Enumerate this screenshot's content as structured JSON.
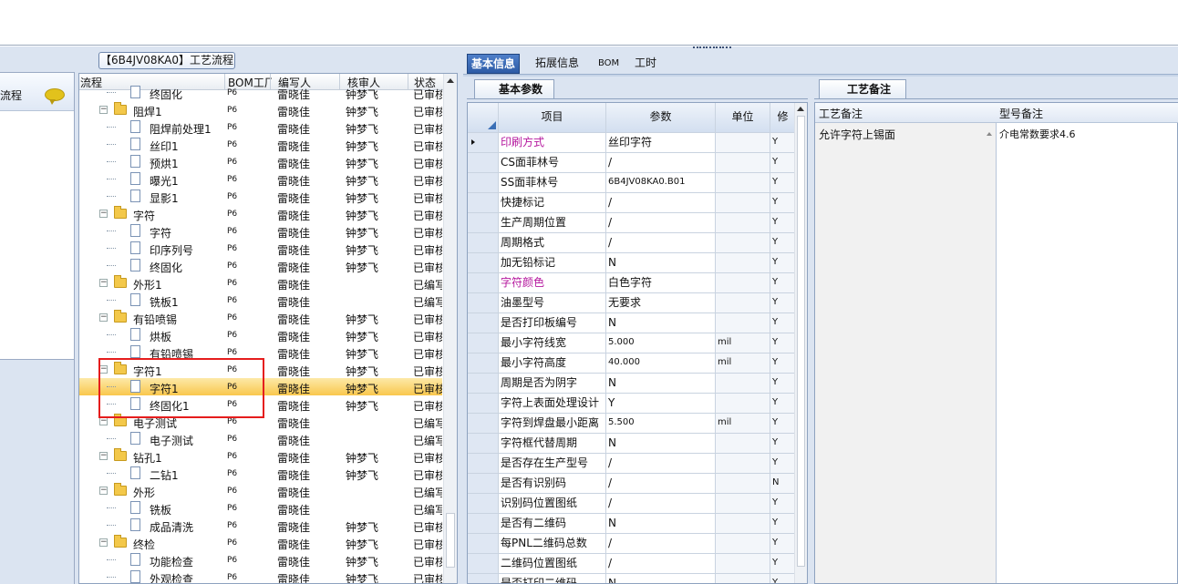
{
  "left_panel": {
    "label": "流程"
  },
  "tree": {
    "title": "【6B4JV08KA0】工艺流程",
    "columns": [
      "流程",
      "BOM工厂",
      "编写人",
      "核审人",
      "状态"
    ],
    "rows": [
      {
        "level": 2,
        "type": "doc",
        "name": "终固化",
        "bom": "P6",
        "author": "雷晓佳",
        "reviewer": "钟梦飞",
        "status": "已审核"
      },
      {
        "level": 1,
        "type": "folder",
        "name": "阻焊1",
        "bom": "P6",
        "author": "雷晓佳",
        "reviewer": "钟梦飞",
        "status": "已审核"
      },
      {
        "level": 2,
        "type": "doc",
        "name": "阻焊前处理1",
        "bom": "P6",
        "author": "雷晓佳",
        "reviewer": "钟梦飞",
        "status": "已审核"
      },
      {
        "level": 2,
        "type": "doc",
        "name": "丝印1",
        "bom": "P6",
        "author": "雷晓佳",
        "reviewer": "钟梦飞",
        "status": "已审核"
      },
      {
        "level": 2,
        "type": "doc",
        "name": "预烘1",
        "bom": "P6",
        "author": "雷晓佳",
        "reviewer": "钟梦飞",
        "status": "已审核"
      },
      {
        "level": 2,
        "type": "doc",
        "name": "曝光1",
        "bom": "P6",
        "author": "雷晓佳",
        "reviewer": "钟梦飞",
        "status": "已审核"
      },
      {
        "level": 2,
        "type": "doc",
        "name": "显影1",
        "bom": "P6",
        "author": "雷晓佳",
        "reviewer": "钟梦飞",
        "status": "已审核"
      },
      {
        "level": 1,
        "type": "folder",
        "name": "字符",
        "bom": "P6",
        "author": "雷晓佳",
        "reviewer": "钟梦飞",
        "status": "已审核"
      },
      {
        "level": 2,
        "type": "doc",
        "name": "字符",
        "bom": "P6",
        "author": "雷晓佳",
        "reviewer": "钟梦飞",
        "status": "已审核"
      },
      {
        "level": 2,
        "type": "doc",
        "name": "印序列号",
        "bom": "P6",
        "author": "雷晓佳",
        "reviewer": "钟梦飞",
        "status": "已审核"
      },
      {
        "level": 2,
        "type": "doc",
        "name": "终固化",
        "bom": "P6",
        "author": "雷晓佳",
        "reviewer": "钟梦飞",
        "status": "已审核"
      },
      {
        "level": 1,
        "type": "folder",
        "name": "外形1",
        "bom": "P6",
        "author": "雷晓佳",
        "reviewer": "",
        "status": "已编写"
      },
      {
        "level": 2,
        "type": "doc",
        "name": "铣板1",
        "bom": "P6",
        "author": "雷晓佳",
        "reviewer": "",
        "status": "已编写"
      },
      {
        "level": 1,
        "type": "folder",
        "name": "有铅喷锡",
        "bom": "P6",
        "author": "雷晓佳",
        "reviewer": "钟梦飞",
        "status": "已审核"
      },
      {
        "level": 2,
        "type": "doc",
        "name": "烘板",
        "bom": "P6",
        "author": "雷晓佳",
        "reviewer": "钟梦飞",
        "status": "已审核"
      },
      {
        "level": 2,
        "type": "doc",
        "name": "有铅喷锡",
        "bom": "P6",
        "author": "雷晓佳",
        "reviewer": "钟梦飞",
        "status": "已审核"
      },
      {
        "level": 1,
        "type": "folder",
        "name": "字符1",
        "bom": "P6",
        "author": "雷晓佳",
        "reviewer": "钟梦飞",
        "status": "已审核"
      },
      {
        "level": 2,
        "type": "doc",
        "name": "字符1",
        "bom": "P6",
        "author": "雷晓佳",
        "reviewer": "钟梦飞",
        "status": "已审核",
        "selected": true
      },
      {
        "level": 2,
        "type": "doc",
        "name": "终固化1",
        "bom": "P6",
        "author": "雷晓佳",
        "reviewer": "钟梦飞",
        "status": "已审核"
      },
      {
        "level": 1,
        "type": "folder",
        "name": "电子测试",
        "bom": "P6",
        "author": "雷晓佳",
        "reviewer": "",
        "status": "已编写"
      },
      {
        "level": 2,
        "type": "doc",
        "name": "电子测试",
        "bom": "P6",
        "author": "雷晓佳",
        "reviewer": "",
        "status": "已编写"
      },
      {
        "level": 1,
        "type": "folder",
        "name": "钻孔1",
        "bom": "P6",
        "author": "雷晓佳",
        "reviewer": "钟梦飞",
        "status": "已审核"
      },
      {
        "level": 2,
        "type": "doc",
        "name": "二钻1",
        "bom": "P6",
        "author": "雷晓佳",
        "reviewer": "钟梦飞",
        "status": "已审核"
      },
      {
        "level": 1,
        "type": "folder",
        "name": "外形",
        "bom": "P6",
        "author": "雷晓佳",
        "reviewer": "",
        "status": "已编写"
      },
      {
        "level": 2,
        "type": "doc",
        "name": "铣板",
        "bom": "P6",
        "author": "雷晓佳",
        "reviewer": "",
        "status": "已编写"
      },
      {
        "level": 2,
        "type": "doc",
        "name": "成品清洗",
        "bom": "P6",
        "author": "雷晓佳",
        "reviewer": "钟梦飞",
        "status": "已审核"
      },
      {
        "level": 1,
        "type": "folder",
        "name": "终检",
        "bom": "P6",
        "author": "雷晓佳",
        "reviewer": "钟梦飞",
        "status": "已审核"
      },
      {
        "level": 2,
        "type": "doc",
        "name": "功能检查",
        "bom": "P6",
        "author": "雷晓佳",
        "reviewer": "钟梦飞",
        "status": "已审核"
      },
      {
        "level": 2,
        "type": "doc",
        "name": "外观检查",
        "bom": "P6",
        "author": "雷晓佳",
        "reviewer": "钟梦飞",
        "status": "已审核"
      }
    ]
  },
  "main_tabs": [
    "基本信息",
    "拓展信息",
    "BOM",
    "工时"
  ],
  "basic_params": {
    "tab": "基本参数",
    "columns": [
      "项目",
      "参数",
      "单位",
      "修"
    ],
    "rows": [
      {
        "item": "印刷方式",
        "value": "丝印字符",
        "unit": "",
        "flag": "Y",
        "highlight": true
      },
      {
        "item": "CS面菲林号",
        "value": "/",
        "unit": "",
        "flag": "Y"
      },
      {
        "item": "SS面菲林号",
        "value": "6B4JV08KA0.B01",
        "unit": "",
        "flag": "Y"
      },
      {
        "item": "快捷标记",
        "value": "/",
        "unit": "",
        "flag": "Y"
      },
      {
        "item": "生产周期位置",
        "value": "/",
        "unit": "",
        "flag": "Y"
      },
      {
        "item": "周期格式",
        "value": "/",
        "unit": "",
        "flag": "Y"
      },
      {
        "item": "加无铅标记",
        "value": "N",
        "unit": "",
        "flag": "Y"
      },
      {
        "item": "字符颜色",
        "value": "白色字符",
        "unit": "",
        "flag": "Y",
        "highlight": true
      },
      {
        "item": "油墨型号",
        "value": "无要求",
        "unit": "",
        "flag": "Y"
      },
      {
        "item": "是否打印板编号",
        "value": "N",
        "unit": "",
        "flag": "Y"
      },
      {
        "item": "最小字符线宽",
        "value": "5.000",
        "unit": "mil",
        "flag": "Y"
      },
      {
        "item": "最小字符高度",
        "value": "40.000",
        "unit": "mil",
        "flag": "Y"
      },
      {
        "item": "周期是否为阴字",
        "value": "N",
        "unit": "",
        "flag": "Y"
      },
      {
        "item": "字符上表面处理设计",
        "value": "Y",
        "unit": "",
        "flag": "Y"
      },
      {
        "item": "字符到焊盘最小距离",
        "value": "5.500",
        "unit": "mil",
        "flag": "Y"
      },
      {
        "item": "字符框代替周期",
        "value": "N",
        "unit": "",
        "flag": "Y"
      },
      {
        "item": "是否存在生产型号",
        "value": "/",
        "unit": "",
        "flag": "Y"
      },
      {
        "item": "是否有识别码",
        "value": "/",
        "unit": "",
        "flag": "N"
      },
      {
        "item": "识别码位置图纸",
        "value": "/",
        "unit": "",
        "flag": "Y"
      },
      {
        "item": "是否有二维码",
        "value": "N",
        "unit": "",
        "flag": "Y"
      },
      {
        "item": "每PNL二维码总数",
        "value": "/",
        "unit": "",
        "flag": "Y"
      },
      {
        "item": "二维码位置图纸",
        "value": "/",
        "unit": "",
        "flag": "Y"
      },
      {
        "item": "是否打印二维码",
        "value": "N",
        "unit": "",
        "flag": "Y"
      }
    ]
  },
  "process_notes": {
    "tab": "工艺备注",
    "columns": [
      "工艺备注",
      "型号备注"
    ],
    "process_note": "允许字符上锡面",
    "model_note": "介电常数要求4.6"
  },
  "colors": {
    "highlight_text": "#b5179e",
    "selection": "#f9c74d",
    "active_tab": "#2d5ba6",
    "red_box": "#e51d1d"
  }
}
